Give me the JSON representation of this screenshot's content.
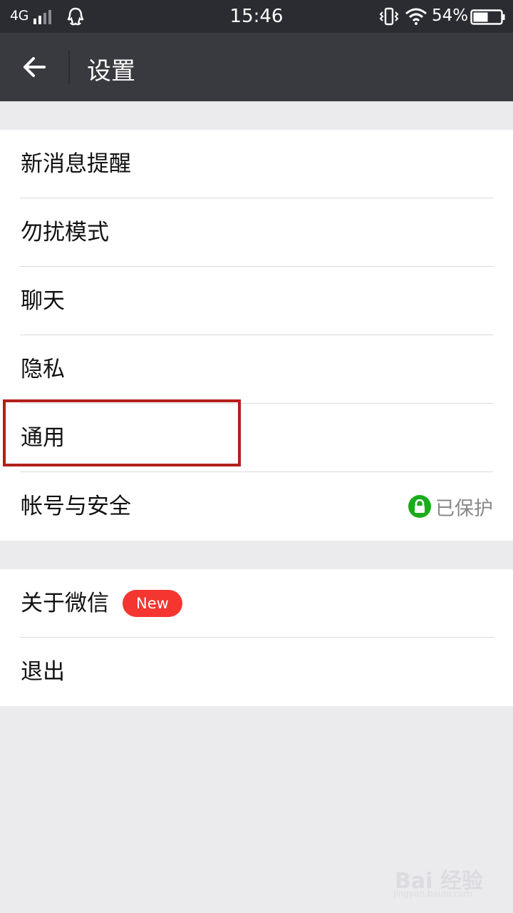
{
  "status_bar": {
    "network": "4G",
    "time": "15:46",
    "battery": "54%",
    "battery_level": 0.54,
    "icons": [
      "signal-icon",
      "qq-icon",
      "vibrate-icon",
      "wifi-icon",
      "battery-icon"
    ]
  },
  "title_bar": {
    "title": "设置",
    "back_icon": "arrow-left-icon"
  },
  "settings_group_1": [
    {
      "label": "新消息提醒"
    },
    {
      "label": "勿扰模式"
    },
    {
      "label": "聊天"
    },
    {
      "label": "隐私"
    },
    {
      "label": "通用"
    },
    {
      "label": "帐号与安全",
      "status": "已保护",
      "status_icon": "lock-icon"
    }
  ],
  "settings_group_2": [
    {
      "label": "关于微信",
      "badge": "New"
    },
    {
      "label": "退出"
    }
  ],
  "watermark": {
    "main": "Bai 经验",
    "sub": "jingyan.baidu.com"
  },
  "colors": {
    "header": "#393a3f",
    "status_bar": "#2b2c31",
    "background": "#ebebee",
    "badge": "#f43530",
    "lock": "#1aad19",
    "highlight": "#b3201b"
  }
}
